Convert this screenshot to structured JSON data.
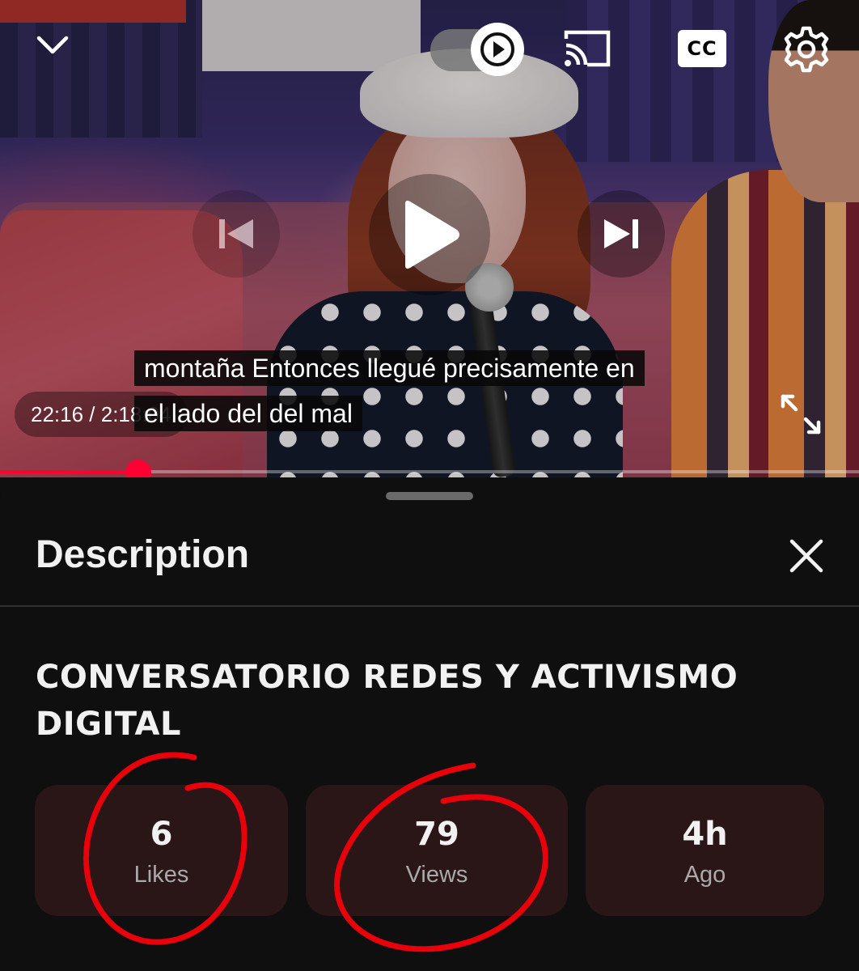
{
  "player": {
    "current_time": "22:16",
    "duration": "2:18:04",
    "time_separator": " / ",
    "progress_fraction": 0.161,
    "caption_line_1": "montaña Entonces llegué precisamente en",
    "caption_line_2": "el lado del del mal",
    "autoplay": "on",
    "cc_label": "CC"
  },
  "panel": {
    "title": "Description",
    "video_title": "CONVERSATORIO REDES Y ACTIVISMO DIGITAL",
    "stats": [
      {
        "value": "6",
        "label": "Likes"
      },
      {
        "value": "79",
        "label": "Views"
      },
      {
        "value": "4h",
        "label": "Ago"
      }
    ]
  },
  "icons": {
    "collapse": "chevron-down-icon",
    "autoplay": "play-icon",
    "cast": "cast-icon",
    "captions": "cc-icon",
    "settings": "gear-icon",
    "previous": "skip-previous-icon",
    "play": "play-icon",
    "next": "skip-next-icon",
    "fullscreen": "fullscreen-icon",
    "close": "close-icon"
  },
  "colors": {
    "accent": "#ff0033",
    "panel_bg": "#0f0f0f",
    "stat_card_bg": "#2a1517",
    "annotation": "#e8000b"
  }
}
